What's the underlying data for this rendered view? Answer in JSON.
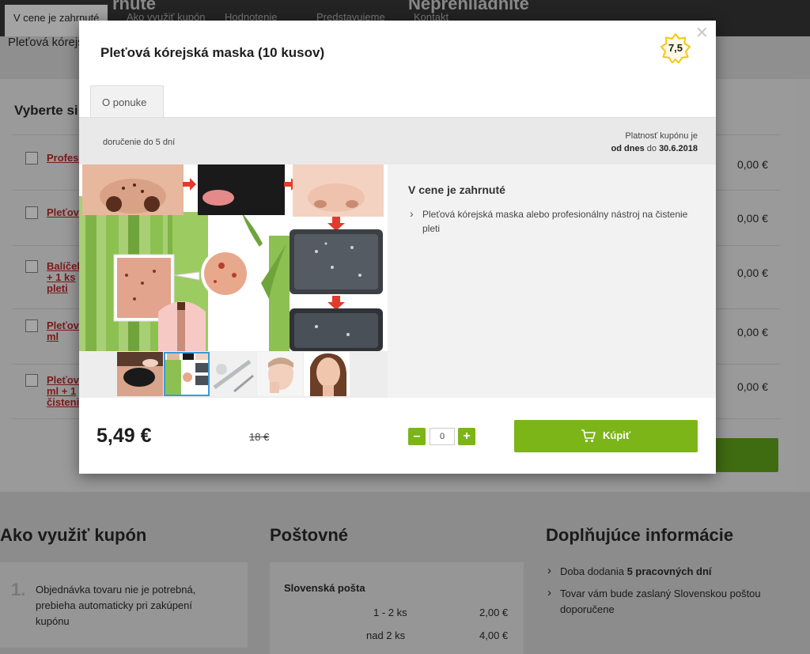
{
  "background": {
    "nav_tabs": [
      "V cene je zahrnuté",
      "Ako využiť kupón",
      "Hodnotenie",
      "Predstavujeme",
      "Kontakt"
    ],
    "big_headings": [
      "rnuté",
      "Neprehliadnite"
    ],
    "sub_title": "Pleťová kórejs",
    "select_title": "Vyberte si",
    "rows": [
      {
        "name": "Profesi",
        "price": "0,00 €"
      },
      {
        "name": "Pleťov",
        "price": "0,00 €"
      },
      {
        "name": "Balíček + 1 ks pleti",
        "price": "0,00 €"
      },
      {
        "name": "Pleťov ml",
        "price": "0,00 €"
      },
      {
        "name": "Pleťov ml + 1 čisteni",
        "price": "0,00 €"
      }
    ],
    "how_to": {
      "title": "Ako využiť kupón",
      "step_number": "1.",
      "step_text": "Objednávka tovaru nie je potrebná, prebieha automaticky pri zakúpení kupónu"
    },
    "postage": {
      "title": "Poštovné",
      "carrier": "Slovenská pošta",
      "rows": [
        {
          "qty": "1 - 2 ks",
          "price": "2,00 €"
        },
        {
          "qty": "nad 2 ks",
          "price": "4,00 €"
        }
      ]
    },
    "additional": {
      "title": "Doplňujúce informácie",
      "item1_prefix": "Doba dodania ",
      "item1_bold": "5 pracovných  dní",
      "item2": "Tovar vám bude zaslaný Slovenskou poštou doporučene"
    }
  },
  "modal": {
    "title": "Pleťová kórejská maska (10 kusov)",
    "rating": "7,5",
    "tab_label": "O ponuke",
    "delivery_text": "doručenie do 5 dní",
    "validity_line1": "Platnosť kupónu je",
    "validity_from": "od dnes",
    "validity_to_word": "do",
    "validity_date": "30.6.2018",
    "included_title": "V cene je zahrnuté",
    "included_item": "Pleťová kórejská maska alebo profesionálny nástroj na čistenie pleti",
    "price": "5,49 €",
    "old_price": "18 €",
    "quantity": "0",
    "minus_label": "–",
    "plus_label": "+",
    "buy_label": "Kúpiť"
  },
  "colors": {
    "accent_green": "#7cb518",
    "thumb_active": "#3a9ad9",
    "badge_star": "#f5c518"
  }
}
